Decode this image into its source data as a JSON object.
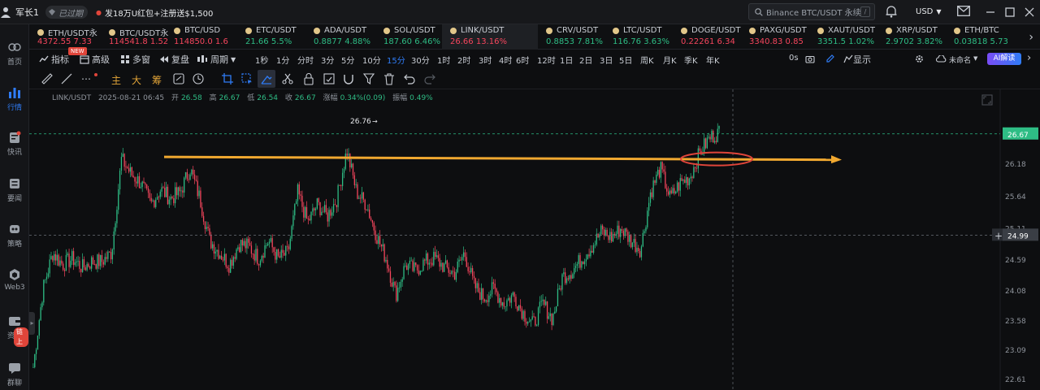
{
  "topbar": {
    "username": "军长1",
    "expired_label": "已过期",
    "promo_text": "发18万U红包+注册送$1,500",
    "search_placeholder": "Binance BTC/USDT 永续",
    "search_shortcut": "/",
    "currency": "USD"
  },
  "sidebar": {
    "items": [
      {
        "label": "首页",
        "icon": "home-icon"
      },
      {
        "label": "行情",
        "icon": "market-chart-icon",
        "active": true
      },
      {
        "label": "快讯",
        "icon": "flash-news-icon"
      },
      {
        "label": "要闻",
        "icon": "news-icon"
      },
      {
        "label": "策略",
        "icon": "strategy-icon"
      },
      {
        "label": "Web3",
        "icon": "web3-icon"
      },
      {
        "label": "资产",
        "icon": "wallet-icon"
      },
      {
        "label": "群聊",
        "icon": "chat-icon"
      }
    ],
    "asset_badge": "链上"
  },
  "tickers": [
    {
      "pair": "ETH/USDT永",
      "price": "4372.55",
      "change": "7.33",
      "dir": "dn"
    },
    {
      "pair": "BTC/USDT永",
      "price": "114541.8",
      "change": "1.52",
      "dir": "dn"
    },
    {
      "pair": "BTC/USD",
      "price": "114850.0",
      "change": "1.6",
      "dir": "dn"
    },
    {
      "pair": "ETC/USDT",
      "price": "21.66",
      "change": "5.5%",
      "dir": "up"
    },
    {
      "pair": "ADA/USDT",
      "price": "0.8877",
      "change": "4.88%",
      "dir": "up"
    },
    {
      "pair": "SOL/USDT",
      "price": "187.60",
      "change": "6.46%",
      "dir": "up"
    },
    {
      "pair": "LINK/USDT",
      "price": "26.66",
      "change": "13.16%",
      "dir": "dn",
      "active": true
    },
    {
      "pair": "CRV/USDT",
      "price": "0.8853",
      "change": "7.81%",
      "dir": "up"
    },
    {
      "pair": "LTC/USDT",
      "price": "116.76",
      "change": "3.63%",
      "dir": "up"
    },
    {
      "pair": "DOGE/USDT",
      "price": "0.22261",
      "change": "6.34",
      "dir": "dn"
    },
    {
      "pair": "PAXG/USDT",
      "price": "3340.83",
      "change": "0.85",
      "dir": "dn"
    },
    {
      "pair": "XAUT/USDT",
      "price": "3351.5",
      "change": "1.02%",
      "dir": "up"
    },
    {
      "pair": "XRP/USDT",
      "price": "2.9702",
      "change": "3.82%",
      "dir": "up"
    },
    {
      "pair": "ETH/BTC",
      "price": "0.03818",
      "change": "5.73",
      "dir": "up"
    }
  ],
  "toolbar": {
    "indicators": "指标",
    "advanced": "高级",
    "new_badge": "NEW",
    "multi_window": "多窗",
    "replay": "复盘",
    "period": "周期",
    "timeframes": [
      "1秒",
      "1分",
      "分时",
      "3分",
      "5分",
      "10分",
      "15分",
      "30分",
      "1时",
      "2时",
      "3时",
      "4时",
      "6时",
      "12时",
      "1日",
      "2日",
      "3日",
      "5日",
      "周K",
      "月K",
      "季K",
      "年K"
    ],
    "active_timeframe": "15分",
    "countdown": "0s",
    "display": "显示",
    "layout_name": "未命名",
    "ai_label": "AI解读"
  },
  "drawing_toolbar": {
    "text_tools": [
      "主",
      "大",
      "筹"
    ]
  },
  "info_line": {
    "symbol": "LINK/USDT",
    "datetime": "2025-08-21 06:45",
    "open_label": "开",
    "open": "26.58",
    "high_label": "高",
    "high": "26.67",
    "low_label": "低",
    "low": "26.54",
    "close_label": "收",
    "close": "26.67",
    "change_label": "涨幅",
    "change": "0.34%(0.09)",
    "amplitude_label": "振幅",
    "amplitude": "0.49%"
  },
  "chart_data": {
    "type": "candlestick",
    "symbol": "LINK/USDT",
    "interval": "15分",
    "ylim": [
      22.5,
      26.95
    ],
    "y_ticks": [
      "26.18",
      "25.64",
      "25.11",
      "24.59",
      "24.08",
      "23.58",
      "23.09",
      "22.61"
    ],
    "last_price": "26.67",
    "crosshair_price": "24.99",
    "peak_label": "26.76",
    "resistance_level": 26.26,
    "colors": {
      "up": "#2ebd85",
      "down": "#f6465d",
      "annotation_line": "#f0a830",
      "annotation_circle": "#e0453a"
    },
    "close_path": [
      22.8,
      24.1,
      24.7,
      24.5,
      24.6,
      24.45,
      24.55,
      24.55,
      24.7,
      26.25,
      26.0,
      25.85,
      25.5,
      25.75,
      25.6,
      25.7,
      26.1,
      25.6,
      24.9,
      24.7,
      24.5,
      24.85,
      24.8,
      24.6,
      24.9,
      24.6,
      24.7,
      25.7,
      25.2,
      25.5,
      25.3,
      25.6,
      26.4,
      25.7,
      25.5,
      25.0,
      24.6,
      24.0,
      24.5,
      24.4,
      24.55,
      24.6,
      24.45,
      24.35,
      24.7,
      24.15,
      23.95,
      24.1,
      23.85,
      24.0,
      23.7,
      23.5,
      23.85,
      23.6,
      24.3,
      24.4,
      24.6,
      24.8,
      25.05,
      24.95,
      25.1,
      24.9,
      24.75,
      25.7,
      26.1,
      25.6,
      25.85,
      25.95,
      26.35,
      26.6,
      26.7
    ]
  }
}
